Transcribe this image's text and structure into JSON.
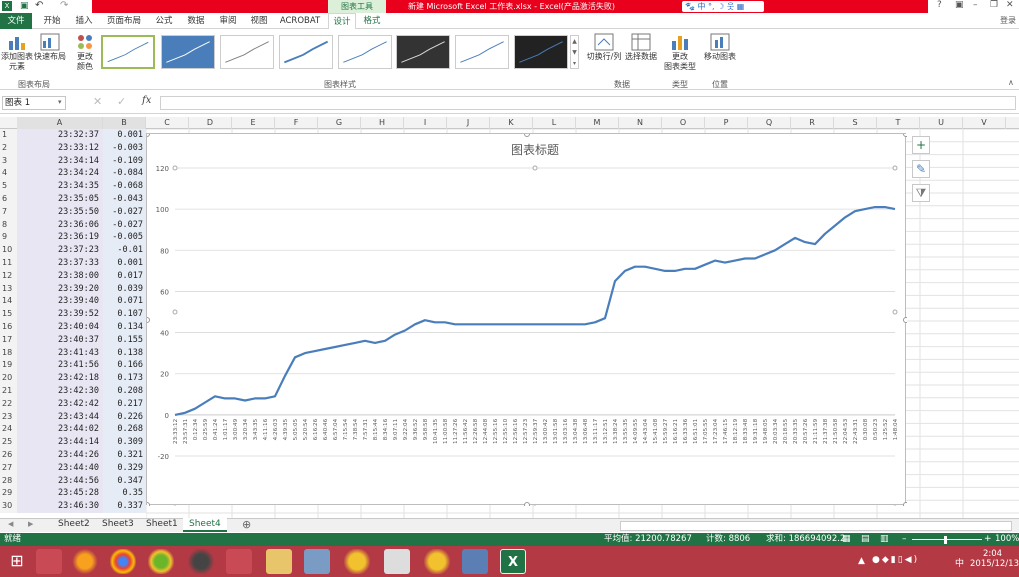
{
  "window": {
    "app_icon": "excel-icon",
    "context_tool": "图表工具",
    "doc_title": "新建 Microsoft Excel 工作表.xlsx - Excel(产品激活失败)",
    "help": "?",
    "login": "登录"
  },
  "tabs": [
    "文件",
    "开始",
    "插入",
    "页面布局",
    "公式",
    "数据",
    "审阅",
    "视图",
    "ACROBAT",
    "设计",
    "格式"
  ],
  "ribbon": {
    "add_element": "添加图表\n元素",
    "quick_layout": "快速布局",
    "change_color": "更改\n颜色",
    "group_layout": "图表布局",
    "group_styles": "图表样式",
    "switch_rowcol": "切换行/列",
    "select_data": "选择数据",
    "group_data": "数据",
    "change_type": "更改\n图表类型",
    "group_type": "类型",
    "move_chart": "移动图表",
    "group_location": "位置"
  },
  "formula": {
    "namebox": "图表 1",
    "fx": "fx",
    "value": ""
  },
  "columns": [
    "A",
    "B",
    "C",
    "D",
    "E",
    "F",
    "G",
    "H",
    "I",
    "J",
    "K",
    "L",
    "M",
    "N",
    "O",
    "P",
    "Q",
    "R",
    "S",
    "T",
    "U",
    "V"
  ],
  "rows": [
    [
      "23:32:37",
      "0.001"
    ],
    [
      "23:33:12",
      "-0.003"
    ],
    [
      "23:34:14",
      "-0.109"
    ],
    [
      "23:34:24",
      "-0.084"
    ],
    [
      "23:34:35",
      "-0.068"
    ],
    [
      "23:35:05",
      "-0.043"
    ],
    [
      "23:35:50",
      "-0.027"
    ],
    [
      "23:36:06",
      "-0.027"
    ],
    [
      "23:36:19",
      "-0.005"
    ],
    [
      "23:37:23",
      "-0.01"
    ],
    [
      "23:37:33",
      "0.001"
    ],
    [
      "23:38:00",
      "0.017"
    ],
    [
      "23:39:20",
      "0.039"
    ],
    [
      "23:39:40",
      "0.071"
    ],
    [
      "23:39:52",
      "0.107"
    ],
    [
      "23:40:04",
      "0.134"
    ],
    [
      "23:40:37",
      "0.155"
    ],
    [
      "23:41:43",
      "0.138"
    ],
    [
      "23:41:56",
      "0.166"
    ],
    [
      "23:42:18",
      "0.173"
    ],
    [
      "23:42:30",
      "0.208"
    ],
    [
      "23:42:42",
      "0.217"
    ],
    [
      "23:43:44",
      "0.226"
    ],
    [
      "23:44:02",
      "0.268"
    ],
    [
      "23:44:14",
      "0.309"
    ],
    [
      "23:44:26",
      "0.321"
    ],
    [
      "23:44:40",
      "0.329"
    ],
    [
      "23:44:56",
      "0.347"
    ],
    [
      "23:45:28",
      "0.35"
    ],
    [
      "23:46:30",
      "0.337"
    ]
  ],
  "chart_data": {
    "type": "line",
    "title": "图表标题",
    "ylim": [
      -20,
      120
    ],
    "yticks": [
      -20,
      0,
      20,
      40,
      60,
      80,
      100,
      120
    ],
    "color": "#4a7ebb",
    "categories": [
      "23:33:12",
      "23:57:31",
      "0:12:34",
      "0:25:59",
      "0:41:24",
      "1:01:17",
      "3:00:49",
      "3:20:34",
      "3:43:35",
      "4:11:16",
      "4:26:03",
      "4:39:35",
      "5:05:05",
      "5:20:54",
      "6:16:26",
      "6:40:46",
      "6:57:04",
      "7:15:54",
      "7:38:54",
      "7:57:31",
      "8:15:44",
      "8:34:16",
      "9:07:11",
      "9:22:04",
      "9:36:52",
      "9:58:58",
      "10:41:35",
      "11:00:58",
      "11:27:26",
      "11:56:42",
      "12:26:58",
      "12:44:08",
      "12:55:16",
      "12:55:10",
      "12:56:16",
      "12:57:23",
      "12:59:37",
      "13:00:42",
      "13:01:58",
      "13:03:16",
      "13:04:38",
      "13:06:48",
      "13:11:17",
      "13:12:51",
      "13:38:24",
      "13:55:35",
      "14:09:55",
      "14:43:04",
      "15:41:08",
      "15:59:27",
      "16:16:21",
      "16:33:36",
      "16:51:01",
      "17:05:55",
      "17:23:04",
      "17:46:15",
      "18:12:19",
      "18:33:48",
      "19:31:18",
      "19:48:05",
      "20:03:34",
      "20:18:55",
      "20:33:35",
      "20:57:26",
      "21:11:59",
      "21:37:38",
      "21:50:58",
      "22:04:53",
      "22:43:31",
      "0:30:08",
      "0:50:23",
      "1:25:52",
      "1:48:04"
    ],
    "series": [
      {
        "values": [
          0,
          1,
          3,
          6,
          9,
          8,
          8,
          7,
          8,
          8,
          9,
          19,
          28,
          30,
          31,
          32,
          33,
          34,
          35,
          36,
          35,
          36,
          39,
          41,
          44,
          46,
          45,
          45,
          44,
          44,
          44,
          44,
          44,
          44,
          44,
          44,
          44,
          44,
          44,
          44,
          44,
          44,
          45,
          47,
          65,
          70,
          72,
          72,
          71,
          70,
          70,
          71,
          71,
          73,
          75,
          74,
          75,
          76,
          76,
          78,
          80,
          83,
          86,
          84,
          83,
          88,
          92,
          96,
          99,
          100,
          101,
          101,
          100
        ]
      }
    ]
  },
  "sheets": [
    "Sheet2",
    "Sheet3",
    "Sheet1",
    "Sheet4"
  ],
  "active_sheet": "Sheet4",
  "status": {
    "ready": "就绪",
    "average": "平均值: 21200.78267",
    "count": "计数: 8806",
    "sum": "求和: 186694092.2",
    "zoom": "100%"
  },
  "clock": {
    "time": "2:04",
    "date": "2015/12/13"
  },
  "ime": "中",
  "colors": {
    "excel_green": "#217346",
    "title_red": "#e8001c",
    "taskbar": "#b33a45",
    "line": "#4a7ebb"
  }
}
